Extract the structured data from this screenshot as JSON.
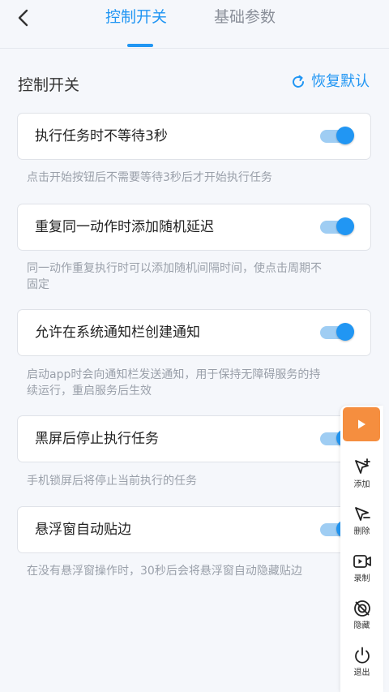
{
  "header": {
    "tabs": [
      {
        "label": "控制开关",
        "active": true
      },
      {
        "label": "基础参数",
        "active": false
      }
    ],
    "accent_color": "#2196f3"
  },
  "section": {
    "title": "控制开关",
    "restore_label": "恢复默认"
  },
  "settings": [
    {
      "label": "执行任务时不等待3秒",
      "enabled": true,
      "description": "点击开始按钮后不需要等待3秒后才开始执行任务"
    },
    {
      "label": "重复同一动作时添加随机延迟",
      "enabled": true,
      "description": "同一动作重复执行时可以添加随机间隔时间，使点击周期不",
      "description_line2": "固定"
    },
    {
      "label": "允许在系统通知栏创建通知",
      "enabled": true,
      "description": "启动app时会向通知栏发送通知，用于保持无障碍服务的持",
      "description_line2": "续运行，重启服务后生效"
    },
    {
      "label": "黑屏后停止执行任务",
      "enabled": true,
      "description": "手机锁屏后将停止当前执行的任务"
    },
    {
      "label": "悬浮窗自动贴边",
      "enabled": true,
      "description": "在没有悬浮窗操作时，30秒后会将悬浮窗自动隐藏贴边"
    }
  ],
  "float_panel": {
    "play_color": "#f58e3f",
    "tools": [
      {
        "label": "添加",
        "icon": "cursor-plus-icon"
      },
      {
        "label": "删除",
        "icon": "cursor-minus-icon"
      },
      {
        "label": "录制",
        "icon": "record-icon"
      },
      {
        "label": "隐藏",
        "icon": "hide-icon"
      },
      {
        "label": "退出",
        "icon": "power-icon"
      }
    ]
  }
}
